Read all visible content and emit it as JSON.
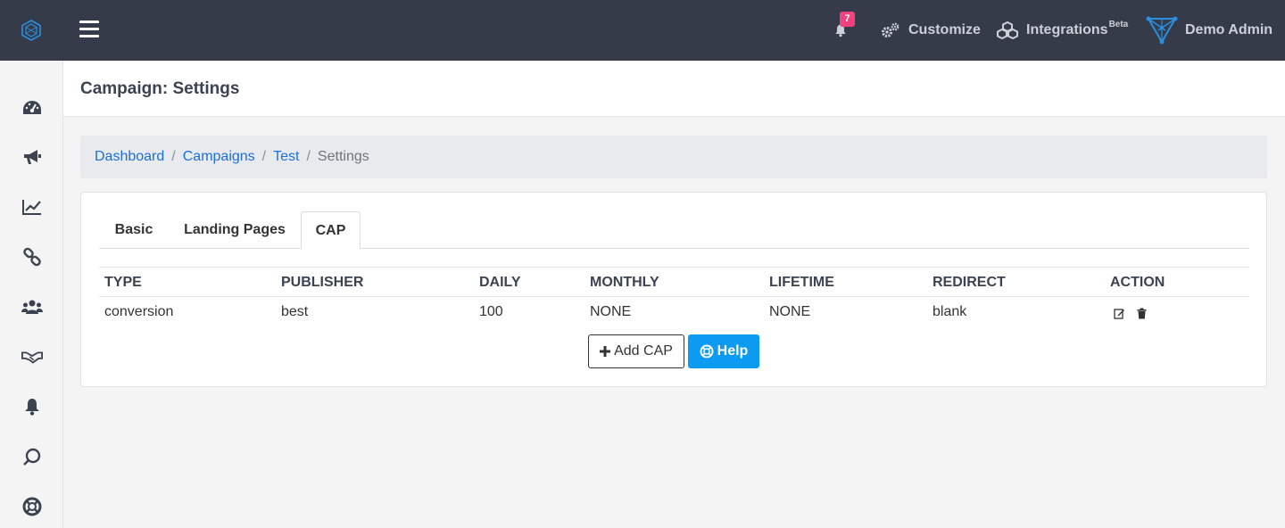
{
  "topbar": {
    "notification_count": "7",
    "customize_label": "Customize",
    "integrations_label": "Integrations",
    "integrations_badge": "Beta",
    "user_name": "Demo Admin"
  },
  "sidebar": {
    "icons": [
      "dashboard-icon",
      "campaigns-icon",
      "reports-icon",
      "links-icon",
      "users-icon",
      "partners-icon",
      "notifications-icon",
      "sync-icon",
      "help-icon"
    ]
  },
  "page": {
    "title": "Campaign: Settings"
  },
  "breadcrumb": {
    "items": [
      "Dashboard",
      "Campaigns",
      "Test"
    ],
    "current": "Settings"
  },
  "tabs": [
    "Basic",
    "Landing Pages",
    "CAP"
  ],
  "active_tab": "CAP",
  "table": {
    "headers": [
      "TYPE",
      "PUBLISHER",
      "DAILY",
      "MONTHLY",
      "LIFETIME",
      "REDIRECT",
      "ACTION"
    ],
    "rows": [
      [
        "conversion",
        "best",
        "100",
        "NONE",
        "NONE",
        "blank"
      ]
    ]
  },
  "buttons": {
    "add_label": "Add CAP",
    "help_label": "Help"
  },
  "colors": {
    "topbar_bg": "#353b49",
    "link": "#1b6fd8",
    "help_button": "#0d9bf2",
    "badge": "#f0437d"
  }
}
